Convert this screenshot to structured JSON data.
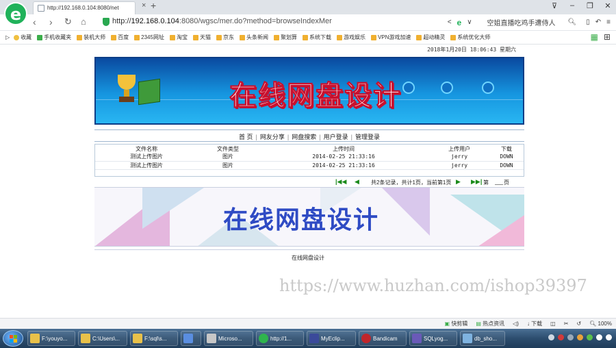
{
  "browser": {
    "logo_letter": "e",
    "tab_title": "http://192.168.0.104:8080/net",
    "tab_close": "×",
    "tab_new": "+",
    "url_prefix": "http://",
    "url_host": "192.168.0.104",
    "url_rest": ":8080/wgsc/mer.do?method=browseIndexMer",
    "search_hint": "空姐直播吃鸡手遭侍人",
    "nav": {
      "back": "‹",
      "forward": "›",
      "reload": "↻",
      "home": "⌂"
    },
    "window_buttons": [
      "⊽",
      "–",
      "❐",
      "✕"
    ],
    "menu_icon": "≡"
  },
  "bookmarks": {
    "items": [
      {
        "label": "收藏",
        "color": "#f0b030"
      },
      {
        "label": "手机收藏夹",
        "color": "#3cae4b"
      },
      {
        "label": "装机大师",
        "color": "#f0b030"
      },
      {
        "label": "百度",
        "color": "#f0b030"
      },
      {
        "label": "2345网址",
        "color": "#f0b030"
      },
      {
        "label": "淘宝",
        "color": "#f0b030"
      },
      {
        "label": "天猫",
        "color": "#f0b030"
      },
      {
        "label": "京东",
        "color": "#f0b030"
      },
      {
        "label": "头条新闻",
        "color": "#f0b030"
      },
      {
        "label": "聚划算",
        "color": "#f0b030"
      },
      {
        "label": "系统下载",
        "color": "#f0b030"
      },
      {
        "label": "游戏娱乐",
        "color": "#f0b030"
      },
      {
        "label": "VPN游戏加速",
        "color": "#f0b030"
      },
      {
        "label": "超动精灵",
        "color": "#f0b030"
      },
      {
        "label": "系统优化大师",
        "color": "#f0b030"
      }
    ]
  },
  "page": {
    "datetime": "2018年1月20日  18:06:43  星期六",
    "banner_title": "在线网盘设计",
    "menu": [
      "首 页",
      "网友分享",
      "网盘搜索",
      "用户登录",
      "管理登录"
    ],
    "menu_sep": "|",
    "table": {
      "headers": [
        "文件名称",
        "文件类型",
        "上传时间",
        "上传用户",
        "下载"
      ],
      "rows": [
        [
          "测试上传图片",
          "图片",
          "2014-02-25 21:33:16",
          "jerry",
          "DOWN"
        ],
        [
          "测试上传图片",
          "图片",
          "2014-02-25 21:33:16",
          "jerry",
          "DOWN"
        ]
      ]
    },
    "pager": {
      "first": "|◀◀",
      "prev": "◀",
      "info": "共2条记录，共计1页，当前第1页",
      "next": "▶",
      "last": "▶▶|",
      "go_label": "第",
      "page_value": "",
      "unit_label": "页"
    },
    "banner2_title": "在线网盘设计",
    "footer_text": "在线网盘设计"
  },
  "watermark": "https://www.huzhan.com/ishop39397",
  "statusbar": {
    "items": [
      "快剪辑",
      "热点资讯",
      "下载",
      "100%"
    ]
  },
  "taskbar": {
    "tasks": [
      {
        "label": "F:\\youyo...",
        "color": "#e8c14a"
      },
      {
        "label": "C:\\Users\\...",
        "color": "#e8c14a"
      },
      {
        "label": "F:\\sql\\s...",
        "color": "#e8c14a"
      },
      {
        "label": "",
        "color": "#5a8ee0"
      },
      {
        "label": "Microso...",
        "color": "#c7c7c7"
      },
      {
        "label": "http://1...",
        "color": "#2fb44d"
      },
      {
        "label": "MyEclip...",
        "color": "#3b4a9a"
      },
      {
        "label": "Bandicam",
        "color": "#c0262b"
      },
      {
        "label": "SQLyog...",
        "color": "#6a5ab8"
      },
      {
        "label": "db_sho...",
        "color": "#7fb3e0"
      }
    ]
  }
}
